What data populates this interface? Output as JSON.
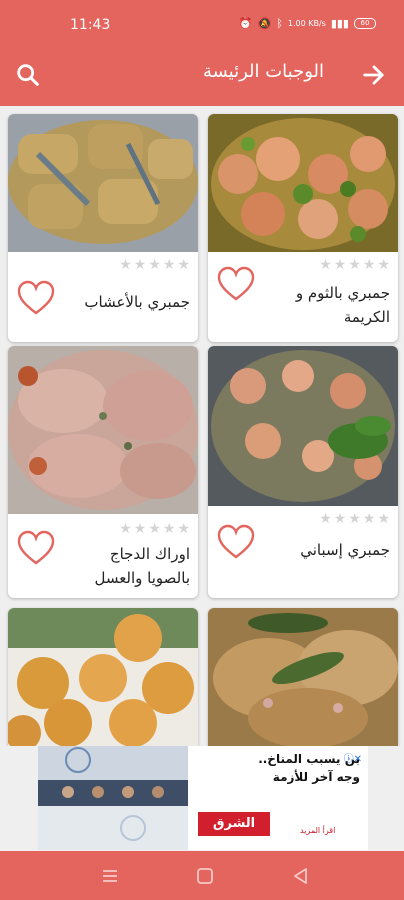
{
  "status_bar": {
    "time": "11:43",
    "net_speed": "1.00 KB/s",
    "battery": "60"
  },
  "app_bar": {
    "title": "الوجبات الرئيسة"
  },
  "recipes": [
    {
      "title": "جمبري بالثوم و الكريمة",
      "stars": 5,
      "rating": 0,
      "image": "shrimp-garlic-cream"
    },
    {
      "title": "جمبري بالأعشاب",
      "stars": 5,
      "rating": 0,
      "image": "herb-shrimp"
    },
    {
      "title": "جمبري إسباني",
      "stars": 5,
      "rating": 0,
      "image": "spanish-shrimp"
    },
    {
      "title": "اوراك الدجاج بالصويا والعسل",
      "stars": 5,
      "rating": 0,
      "image": "chicken-thighs"
    },
    {
      "title": "",
      "stars": 5,
      "rating": 0,
      "image": "chicken-herbs"
    },
    {
      "title": "",
      "stars": 5,
      "rating": 0,
      "image": "fried-balls"
    }
  ],
  "ad": {
    "headline": "بن يسبب المناخ..",
    "subline": "وجه آخر للأزمة",
    "brand": "الشرق",
    "small": "اقرأ المزيد"
  },
  "colors": {
    "primary": "#e4645e",
    "heart": "#e4645e",
    "star_empty": "#d4d4d4"
  }
}
